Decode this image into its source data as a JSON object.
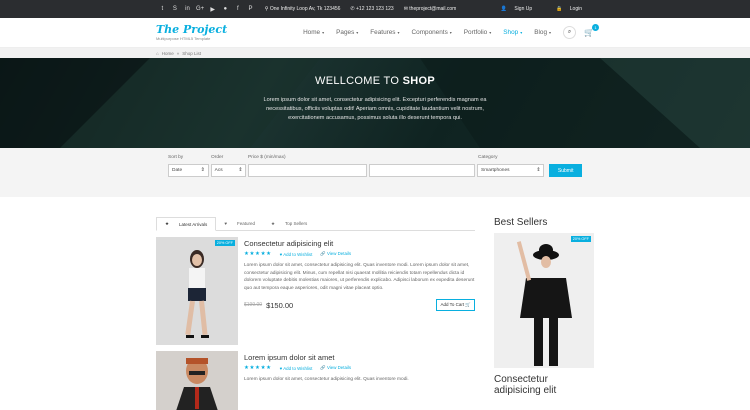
{
  "topbar": {
    "socials": [
      "twitter-icon",
      "skype-icon",
      "linkedin-icon",
      "google-plus-icon",
      "youtube-icon",
      "flickr-icon",
      "facebook-icon",
      "pinterest-icon"
    ],
    "address": "One Infinity Loop Av, Tk 123456",
    "phone": "+12 123 123 123",
    "email": "theproject@mail.com",
    "signup": "Sign Up",
    "login": "Login"
  },
  "brand": {
    "name": "The Project",
    "tagline": "Multipurpose HTML5 Template"
  },
  "nav": {
    "items": [
      "Home",
      "Pages",
      "Features",
      "Components",
      "Portfolio",
      "Shop",
      "Blog"
    ],
    "active": "Shop",
    "cart_count": "1"
  },
  "breadcrumb": {
    "home": "Home",
    "current": "Shop List"
  },
  "hero": {
    "title_plain": "WELLCOME TO ",
    "title_bold": "SHOP",
    "text": "Lorem ipsum dolor sit amet, consectetur adipisicing elit. Excepturi perferendis magnam ea necessitatibus, officiis voluptas odit! Aperiam omnis, cupiditate laudantium velit nostrum, exercitationem accusamus, possimus soluta illo deserunt tempora qui."
  },
  "filters": {
    "sort_label": "Sort by",
    "sort_value": "Date",
    "order_label": "Order",
    "order_value": "Acs",
    "price_label": "Price $ (min/max)",
    "category_label": "Category",
    "category_value": "Smartphones",
    "submit": "Submit"
  },
  "tabs": [
    "Latest Arrivals",
    "Featured",
    "Top Sellers"
  ],
  "products": [
    {
      "title": "Consectetur adipisicing elit",
      "sale": "20% OFF",
      "wishlist": "Add to Wishlist",
      "details": "View Details",
      "desc": "Lorem ipsum dolor sit amet, consectetur adipisicing elit. Quas inventore modi. Lorem ipsum dolor sit amet, consectetur adipisicing elit. Minus, cum repellat nisi quaerat mollitia reiciendis totam repellendus dicta id dolorem voluptate debitis molestias maiores, ut perferendis explicabo. Adipisci laborum ex expedita deserunt quo aut tempora eaque asperiores, odit magni vitae placeat optio.",
      "old_price": "$199.00",
      "price": "$150.00",
      "add": "Add To Cart"
    },
    {
      "title": "Lorem ipsum dolor sit amet",
      "wishlist": "Add to Wishlist",
      "details": "View Details",
      "desc": "Lorem ipsum dolor sit amet, consectetur adipisicing elit. Quas inventore modi."
    }
  ],
  "sidebar": {
    "title": "Best Sellers",
    "sale": "20% OFF",
    "product": "Consectetur adipisicing elit"
  }
}
